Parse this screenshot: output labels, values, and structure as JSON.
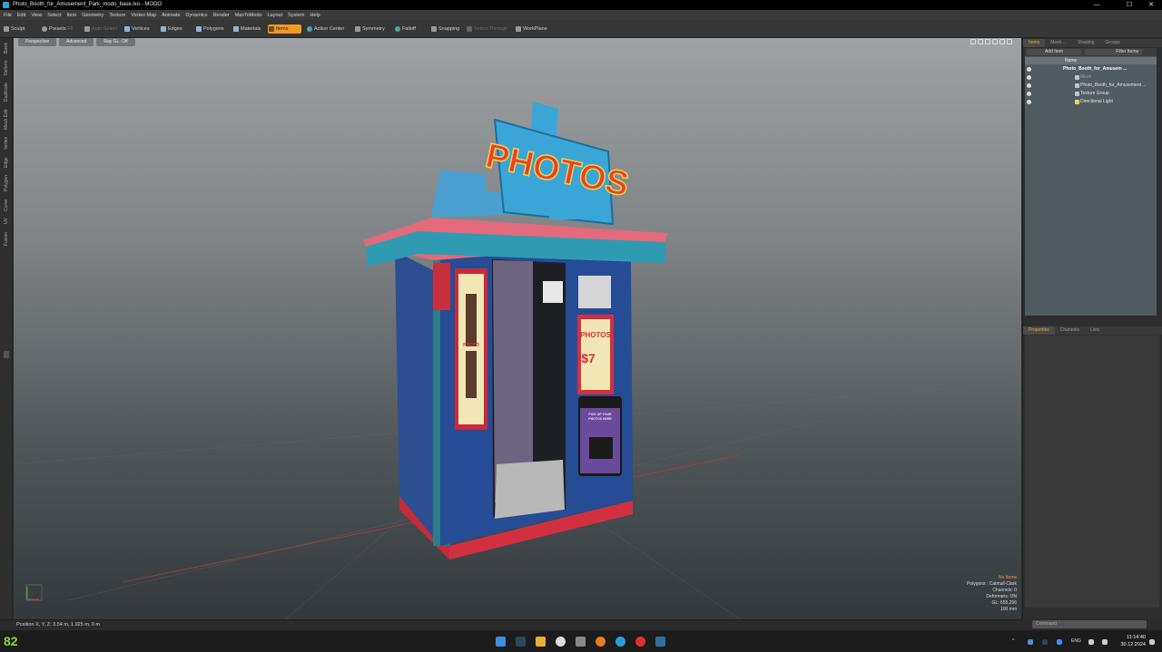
{
  "window": {
    "title": "Photo_Booth_for_Amusement_Park_modo_base.lxo - MODO",
    "controls": [
      "—",
      "☐",
      "✕"
    ]
  },
  "menu": [
    "File",
    "Edit",
    "View",
    "Select",
    "Item",
    "Geometry",
    "Texture",
    "Vertex Map",
    "Animate",
    "Dynamics",
    "Render",
    "MaxToModo",
    "Layout",
    "System",
    "Help"
  ],
  "toolbar": {
    "sculpt": "Sculpt",
    "presets": "Presets",
    "presets_key": "F6",
    "auto_select": "Auto Select",
    "vertices": "Vertices",
    "edges": "Edges",
    "polygons": "Polygons",
    "materials": "Materials",
    "items": "Items",
    "action_center": "Action Center",
    "symmetry": "Symmetry",
    "falloff": "Falloff",
    "snapping": "Snapping",
    "select_through": "Select Through",
    "workplane": "WorkPlane"
  },
  "left_tabs": [
    "Basic",
    "Deform",
    "Duplicate",
    "Mesh Edit",
    "Vertex",
    "Edge",
    "Polygon",
    "Curve",
    "UV",
    "Fusion"
  ],
  "viewport": {
    "view": "Perspective",
    "shading": "Advanced",
    "ray_gl": "Ray GL: Off"
  },
  "booth": {
    "sign": "PHOTOS",
    "poster_top": "PHOTO",
    "poster_price": "$7",
    "poster_right": "PHOTOS",
    "pickup_1": "PICK UP YOUR",
    "pickup_2": "PHOTOS HERE"
  },
  "hud": {
    "selection": "No Items",
    "polygons": "Polygons : Catmull-Clark",
    "channels": "Channels: 0",
    "deformers": "Deformers: ON",
    "gl": "GL: 655,256",
    "scale": "100 mm"
  },
  "status": {
    "position": "Position X, Y, Z:   3.54 m, 1.925 m, 0 m"
  },
  "right_panel": {
    "tabs": [
      "Items",
      "Mesh ...",
      "Shading",
      "Groups"
    ],
    "add_item": "Add Item",
    "filter_items": "Filter Items",
    "column": "Name",
    "rows": [
      "Photo_Booth_for_Amusem ...",
      "Mesh",
      "Photo_Booth_for_Amusement ...",
      "Texture Group",
      "Directional Light"
    ],
    "prop_tabs": [
      "Properties",
      "Channels",
      "Lists"
    ],
    "command": "Command"
  },
  "taskbar": {
    "fps": "82",
    "lang": "ENG",
    "time": "11:14:40",
    "date": "30.12.2024"
  }
}
